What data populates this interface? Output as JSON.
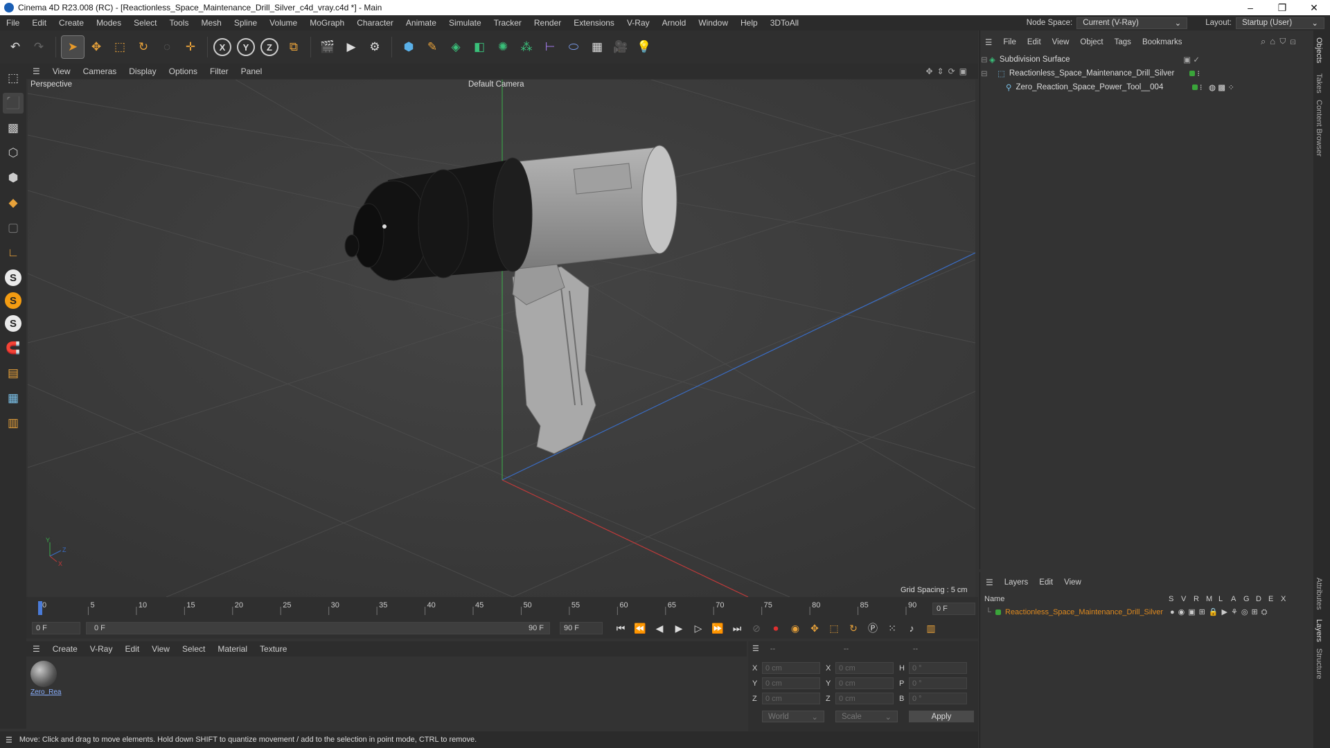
{
  "window": {
    "title": "Cinema 4D R23.008 (RC) - [Reactionless_Space_Maintenance_Drill_Silver_c4d_vray.c4d *] - Main",
    "controls": [
      "–",
      "❐",
      "✕"
    ]
  },
  "menubar": {
    "items": [
      "File",
      "Edit",
      "Create",
      "Modes",
      "Select",
      "Tools",
      "Mesh",
      "Spline",
      "Volume",
      "MoGraph",
      "Character",
      "Animate",
      "Simulate",
      "Tracker",
      "Render",
      "Extensions",
      "V-Ray",
      "Arnold",
      "Window",
      "Help",
      "3DToAll"
    ],
    "node_space_label": "Node Space:",
    "node_space_value": "Current (V-Ray)",
    "layout_label": "Layout:",
    "layout_value": "Startup (User)"
  },
  "toolbar": {
    "icons": [
      "undo-icon",
      "redo-icon",
      "select-icon",
      "move-icon",
      "scale-icon",
      "rotate-icon",
      "live-select-icon",
      "add-icon",
      "x-axis-icon",
      "y-axis-icon",
      "z-axis-icon",
      "coordinate-icon",
      "render-region-icon",
      "render-view-icon",
      "render-settings-icon",
      "cube-icon",
      "pen-icon",
      "subdivision-icon",
      "extrude-icon",
      "array-icon",
      "mograph-icon",
      "bend-icon",
      "field-icon",
      "floor-icon",
      "camera-icon",
      "light-icon"
    ]
  },
  "left_tools": {
    "icons": [
      "model-mode-icon",
      "texture-mode-icon",
      "point-mode-icon",
      "edge-mode-icon",
      "polygon-mode-icon",
      "object-axis-icon",
      "workplane-icon",
      "snap-s-icon",
      "snap-s2-icon",
      "snap-s3-icon",
      "magnet-icon",
      "grid-icon",
      "workplane-grid-icon",
      "quantize-icon"
    ],
    "round_labels": [
      "S",
      "S",
      "S"
    ]
  },
  "viewport": {
    "menu": [
      "View",
      "Cameras",
      "Display",
      "Options",
      "Filter",
      "Panel"
    ],
    "mode_label": "Perspective",
    "camera_label": "Default Camera",
    "grid_spacing": "Grid Spacing : 5 cm",
    "axis_labels": {
      "y": "Y",
      "z": "Z",
      "x": "X"
    }
  },
  "timeline": {
    "ticks": [
      "0",
      "5",
      "10",
      "15",
      "20",
      "25",
      "30",
      "35",
      "40",
      "45",
      "50",
      "55",
      "60",
      "65",
      "70",
      "75",
      "80",
      "85",
      "90"
    ],
    "current_frame_right": "0 F",
    "start_field": "0 F",
    "range_start": "0 F",
    "range_end": "90 F",
    "end_field": "90 F"
  },
  "material_manager": {
    "menu": [
      "Create",
      "V-Ray",
      "Edit",
      "View",
      "Select",
      "Material",
      "Texture"
    ],
    "materials": [
      {
        "name": "Zero_Rea"
      }
    ]
  },
  "coordinates": {
    "headers": [
      "--",
      "--",
      "--"
    ],
    "rows": [
      {
        "axis": "X",
        "pos": "0 cm",
        "axis2": "X",
        "size": "0 cm",
        "axis3": "H",
        "rot": "0 °"
      },
      {
        "axis": "Y",
        "pos": "0 cm",
        "axis2": "Y",
        "size": "0 cm",
        "axis3": "P",
        "rot": "0 °"
      },
      {
        "axis": "Z",
        "pos": "0 cm",
        "axis2": "Z",
        "size": "0 cm",
        "axis3": "B",
        "rot": "0 °"
      }
    ],
    "mode_world": "World",
    "mode_scale": "Scale",
    "apply_label": "Apply"
  },
  "status": {
    "text": "Move: Click and drag to move elements. Hold down SHIFT to quantize movement / add to the selection in point mode, CTRL to remove."
  },
  "object_manager": {
    "menu": [
      "File",
      "Edit",
      "View",
      "Object",
      "Tags",
      "Bookmarks"
    ],
    "objects": [
      {
        "name": "Subdivision Surface"
      },
      {
        "name": "Reactionless_Space_Maintenance_Drill_Silver"
      },
      {
        "name": "Zero_Reaction_Space_Power_Tool__004"
      }
    ]
  },
  "layer_manager": {
    "menu": [
      "Layers",
      "Edit",
      "View"
    ],
    "col_name": "Name",
    "col_flags": [
      "S",
      "V",
      "R",
      "M",
      "L",
      "A",
      "G",
      "D",
      "E",
      "X"
    ],
    "layers": [
      {
        "name": "Reactionless_Space_Maintenance_Drill_Silver",
        "color": "#3aa53a"
      }
    ]
  },
  "side_tabs": [
    "Objects",
    "Takes",
    "Content Browser",
    "Attributes",
    "Layers",
    "Structure"
  ],
  "colors": {
    "accent_green": "#3aa53a",
    "layer_text": "#e08a1e",
    "axis_red": "#c03a3a",
    "axis_blue": "#3a6ec8",
    "axis_green": "#3ab04a"
  }
}
